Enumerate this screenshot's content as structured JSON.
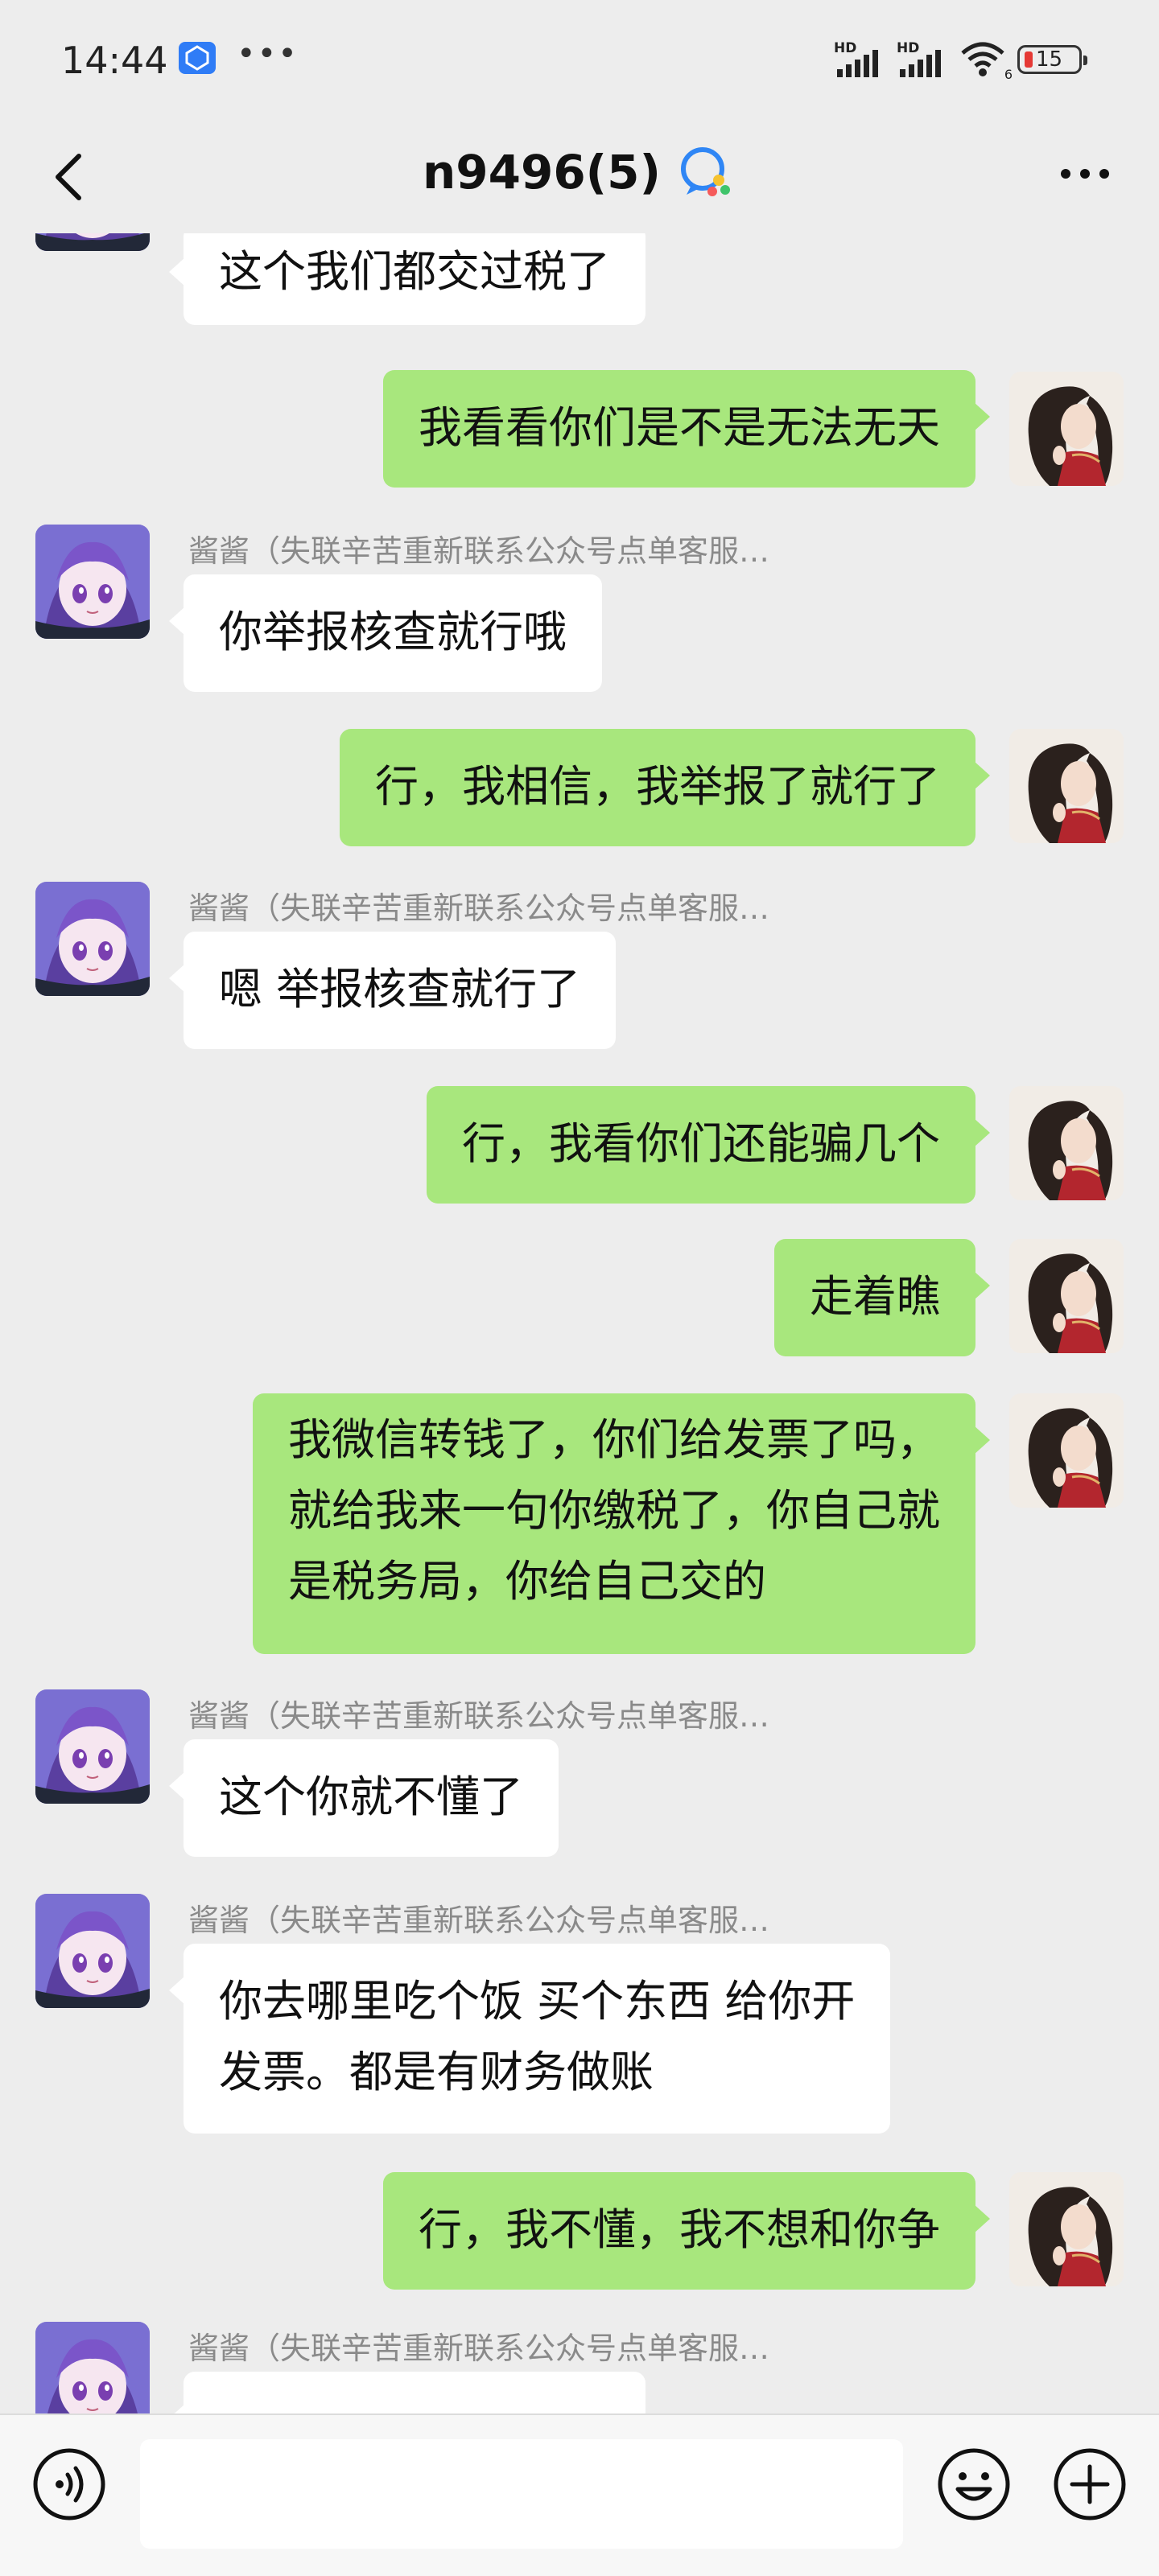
{
  "status_bar": {
    "time": "14:44",
    "dots": "•••",
    "signal1_label": "HD",
    "signal2_label": "HD",
    "wifi_label": "6",
    "battery": "15"
  },
  "header": {
    "title": "n9496(5)"
  },
  "messages": {
    "m1": {
      "side": "in",
      "text": "这个我们都交过税了"
    },
    "m2": {
      "side": "out",
      "text": "我看看你们是不是无法无天"
    },
    "m3": {
      "side": "in",
      "sender": "酱酱（失联辛苦重新联系公众号点单客服…",
      "text": "你举报核查就行哦"
    },
    "m4": {
      "side": "out",
      "text": "行，我相信，我举报了就行了"
    },
    "m5": {
      "side": "in",
      "sender": "酱酱（失联辛苦重新联系公众号点单客服…",
      "text": "嗯 举报核查就行了"
    },
    "m6": {
      "side": "out",
      "text": "行，我看你们还能骗几个"
    },
    "m7": {
      "side": "out",
      "text": "走着瞧"
    },
    "m8": {
      "side": "out",
      "lines": [
        "我微信转钱了，你们给发票了吗，",
        "就给我来一句你缴税了，你自己就",
        "是税务局，你给自己交的"
      ]
    },
    "m9": {
      "side": "in",
      "sender": "酱酱（失联辛苦重新联系公众号点单客服…",
      "text": "这个你就不懂了"
    },
    "m10": {
      "side": "in",
      "sender": "酱酱（失联辛苦重新联系公众号点单客服…",
      "lines": [
        "你去哪里吃个饭 买个东西 给你开",
        "发票。都是有财务做账"
      ]
    },
    "m11": {
      "side": "out",
      "text": "行，我不懂，我不想和你争"
    },
    "m12": {
      "side": "in",
      "sender": "酱酱（失联辛苦重新联系公众号点单客服…",
      "text": ""
    }
  },
  "input": {
    "value": "",
    "placeholder": ""
  },
  "colors": {
    "background": "#ededed",
    "outgoing_bubble": "#a8e77d",
    "incoming_bubble": "#ffffff",
    "battery_low": "#e53935"
  },
  "icons": [
    "back-arrow-icon",
    "ai-assistant-icon",
    "more-icon",
    "voice-icon",
    "emoji-icon",
    "plus-icon"
  ]
}
